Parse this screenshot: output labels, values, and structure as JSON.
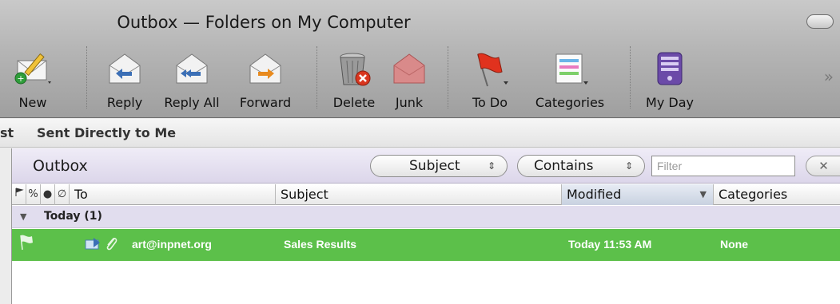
{
  "window": {
    "title": "Outbox — Folders on My Computer"
  },
  "toolbar": {
    "new": "New",
    "reply": "Reply",
    "reply_all": "Reply All",
    "forward": "Forward",
    "delete": "Delete",
    "junk": "Junk",
    "to_do": "To Do",
    "categories": "Categories",
    "my_day": "My Day"
  },
  "favorites": {
    "partial": "st",
    "sent_directly": "Sent Directly to Me"
  },
  "filterbar": {
    "folder_title": "Outbox",
    "field_select": "Subject",
    "operator_select": "Contains",
    "filter_placeholder": "Filter",
    "clear_icon": "clear-x-icon"
  },
  "columns": {
    "flag_icon": "flag-icon",
    "link_icon": "link-icon",
    "status_icon": "status-dot-icon",
    "attachment_icon": "paperclip-icon",
    "to": "To",
    "subject": "Subject",
    "modified": "Modified",
    "categories": "Categories"
  },
  "group": {
    "title": "Today (1)"
  },
  "messages": [
    {
      "to": "art@inpnet.org",
      "subject": "Sales Results",
      "modified": "Today 11:53 AM",
      "categories": "None"
    }
  ],
  "colors": {
    "selected_row": "#5cc04a",
    "group_row": "#e1ddee",
    "filterbar": "#dcd6ea"
  }
}
